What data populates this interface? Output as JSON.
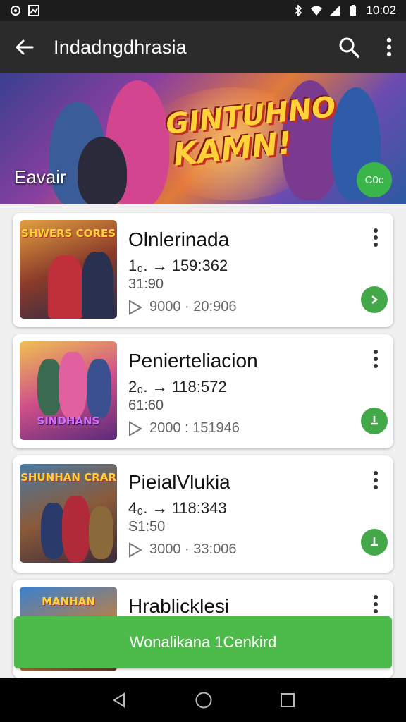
{
  "status_bar": {
    "time": "10:02"
  },
  "toolbar": {
    "title": "Indadngdhrasia"
  },
  "banner": {
    "logo_line1": "GINTUHNO",
    "logo_line2": "KAMN!",
    "caption": "Eavair",
    "badge": "C0c"
  },
  "items": [
    {
      "name": "Olnlerinada",
      "line1": "1₀. → 159:362",
      "line2": "31:90",
      "line3": "9000 · 20:906",
      "action": "arrow",
      "thumb_title": "SHWERS CORES"
    },
    {
      "name": "Penierteliacion",
      "line1": "2₀. → 118:572",
      "line2": "61:60",
      "line3": "2000 : 151946",
      "action": "download",
      "thumb_title": "SINDHANS"
    },
    {
      "name": "PieialVlukia",
      "line1": "4₀. → 118:343",
      "line2": "S1:50",
      "line3": "3000 · 33:006",
      "action": "download",
      "thumb_title": "SHUNHAN CRAR"
    },
    {
      "name": "Hrablicklesi",
      "thumb_title": "MANHAN"
    }
  ],
  "cta": {
    "label": "Wonalikana 1Cenkird"
  },
  "colors": {
    "accent": "#4dbb4a",
    "toolbar": "#2b2b2b"
  },
  "icons": [
    "back-arrow-icon",
    "search-icon",
    "more-vertical-icon",
    "play-icon",
    "chevron-right-icon",
    "download-icon"
  ]
}
